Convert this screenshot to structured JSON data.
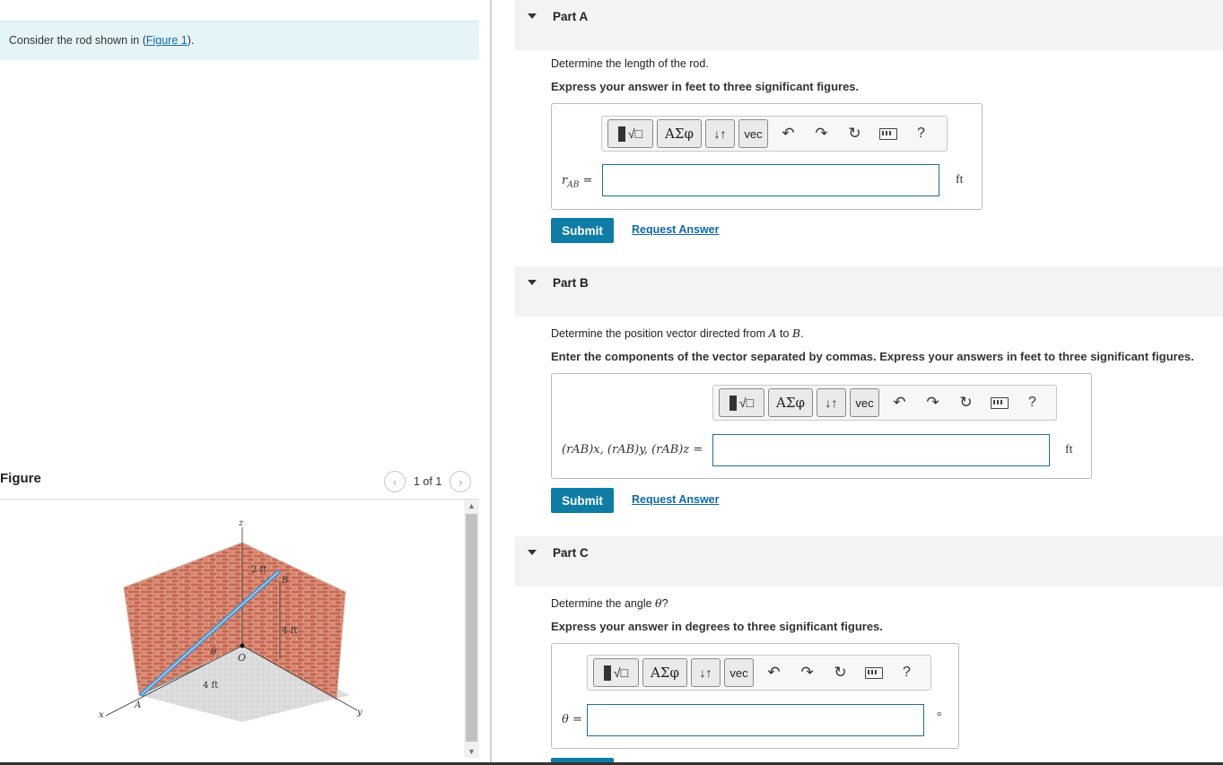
{
  "intro": {
    "prefix": "Consider the rod shown in (",
    "link": "Figure 1",
    "suffix": ")."
  },
  "figure": {
    "title": "Figure",
    "pager": "1 of 1",
    "prev_icon": "‹",
    "next_icon": "›",
    "labels": {
      "z": "z",
      "x": "x",
      "y": "y",
      "A": "A",
      "B": "B",
      "O": "O",
      "theta": "θ",
      "d1": "2 ft",
      "d2": "4 ft",
      "d3": "4 ft"
    }
  },
  "toolbar": {
    "templates": "√□",
    "greek": "ΑΣφ",
    "arrows": "↓↑",
    "vec": "vec",
    "undo": "↶",
    "redo": "↷",
    "reset": "↻",
    "help": "?"
  },
  "partA": {
    "title": "Part A",
    "question": "Determine the length of the rod.",
    "instruction": "Express your answer in feet to three significant figures.",
    "label": "r",
    "label_sub": "AB",
    "equals": " =",
    "value": "",
    "unit": "ft",
    "submit": "Submit",
    "request": "Request Answer"
  },
  "partB": {
    "title": "Part B",
    "question_prefix": "Determine the position vector directed from ",
    "question_A": "A",
    "question_mid": " to ",
    "question_B": "B",
    "question_suffix": ".",
    "instruction": "Enter the components of the vector separated by commas. Express your answers in feet to three significant figures.",
    "label": "(rAB)x, (rAB)y, (rAB)z =",
    "value": "",
    "unit": "ft",
    "submit": "Submit",
    "request": "Request Answer"
  },
  "partC": {
    "title": "Part C",
    "question_prefix": "Determine the angle ",
    "question_theta": "θ",
    "question_suffix": "?",
    "instruction": "Express your answer in degrees to three significant figures.",
    "label": "θ =",
    "value": "",
    "unit": "°"
  },
  "colors": {
    "accent": "#0f7ca6",
    "intro_bg": "#e5f4f7",
    "part_bg": "#f3f3f3",
    "input_border": "#1f6f97"
  }
}
